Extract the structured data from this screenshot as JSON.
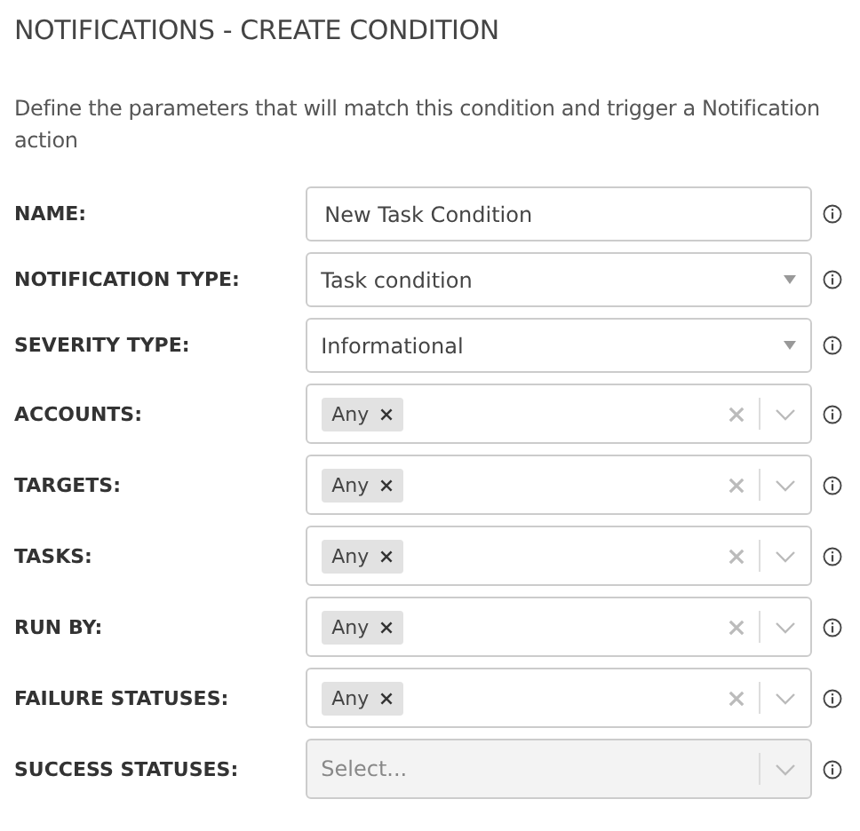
{
  "title": "NOTIFICATIONS - CREATE CONDITION",
  "description": "Define the parameters that will match this condition and trigger a Notification action",
  "fields": [
    {
      "label": "NAME:",
      "kind": "text",
      "value": "New Task Condition"
    },
    {
      "label": "NOTIFICATION TYPE:",
      "kind": "dropdown",
      "value": "Task condition"
    },
    {
      "label": "SEVERITY TYPE:",
      "kind": "dropdown",
      "value": "Informational"
    },
    {
      "label": "ACCOUNTS:",
      "kind": "multi",
      "tags": [
        "Any"
      ],
      "disabled": false
    },
    {
      "label": "TARGETS:",
      "kind": "multi",
      "tags": [
        "Any"
      ],
      "disabled": false
    },
    {
      "label": "TASKS:",
      "kind": "multi",
      "tags": [
        "Any"
      ],
      "disabled": false
    },
    {
      "label": "RUN BY:",
      "kind": "multi",
      "tags": [
        "Any"
      ],
      "disabled": false
    },
    {
      "label": "FAILURE STATUSES:",
      "kind": "multi",
      "tags": [
        "Any"
      ],
      "disabled": false
    },
    {
      "label": "SUCCESS STATUSES:",
      "kind": "multi",
      "placeholder": "Select...",
      "disabled": true
    }
  ]
}
